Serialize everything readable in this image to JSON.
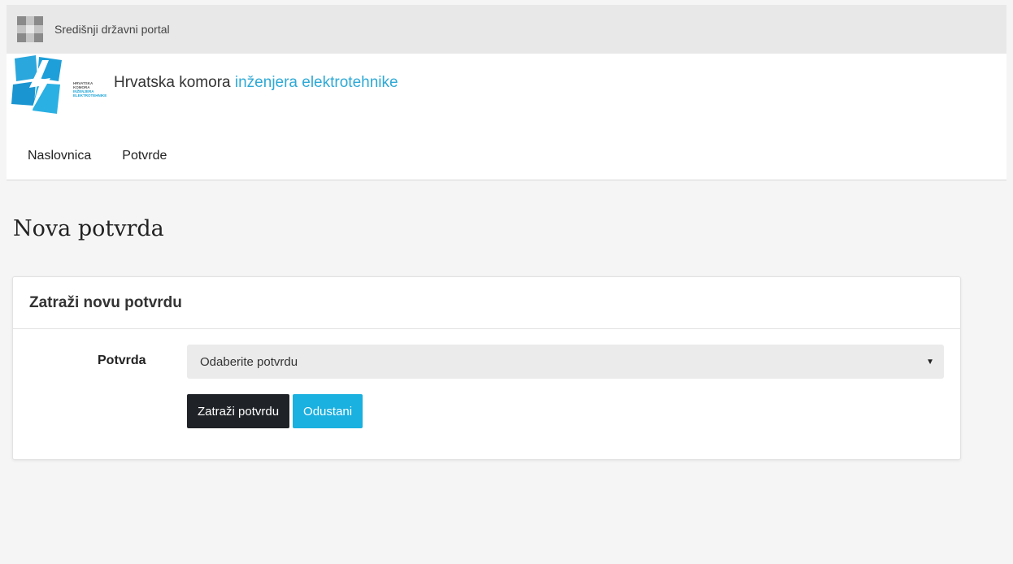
{
  "gov_bar": {
    "title": "Središnji državni portal",
    "logo_icon": "croatian-checkerboard-icon"
  },
  "header": {
    "logo_lines": [
      "HRVATSKA",
      "KOMORA",
      "INŽENJERA",
      "ELEKTROTEHNIKE"
    ],
    "name_plain": "Hrvatska komora",
    "name_accent": "inženjera elektrotehnike",
    "accent_color": "#2ea9d6"
  },
  "nav": {
    "items": [
      {
        "label": "Naslovnica"
      },
      {
        "label": "Potvrde"
      }
    ]
  },
  "main": {
    "page_title": "Nova potvrda",
    "card": {
      "title": "Zatraži novu potvrdu",
      "field_label": "Potvrda",
      "select_value": "Odaberite potvrdu",
      "submit_label": "Zatraži potvrdu",
      "cancel_label": "Odustani"
    }
  },
  "colors": {
    "primary_dark": "#1f2226",
    "info_blue": "#1ab0e0",
    "logo_blue": "#1aa3d6"
  }
}
